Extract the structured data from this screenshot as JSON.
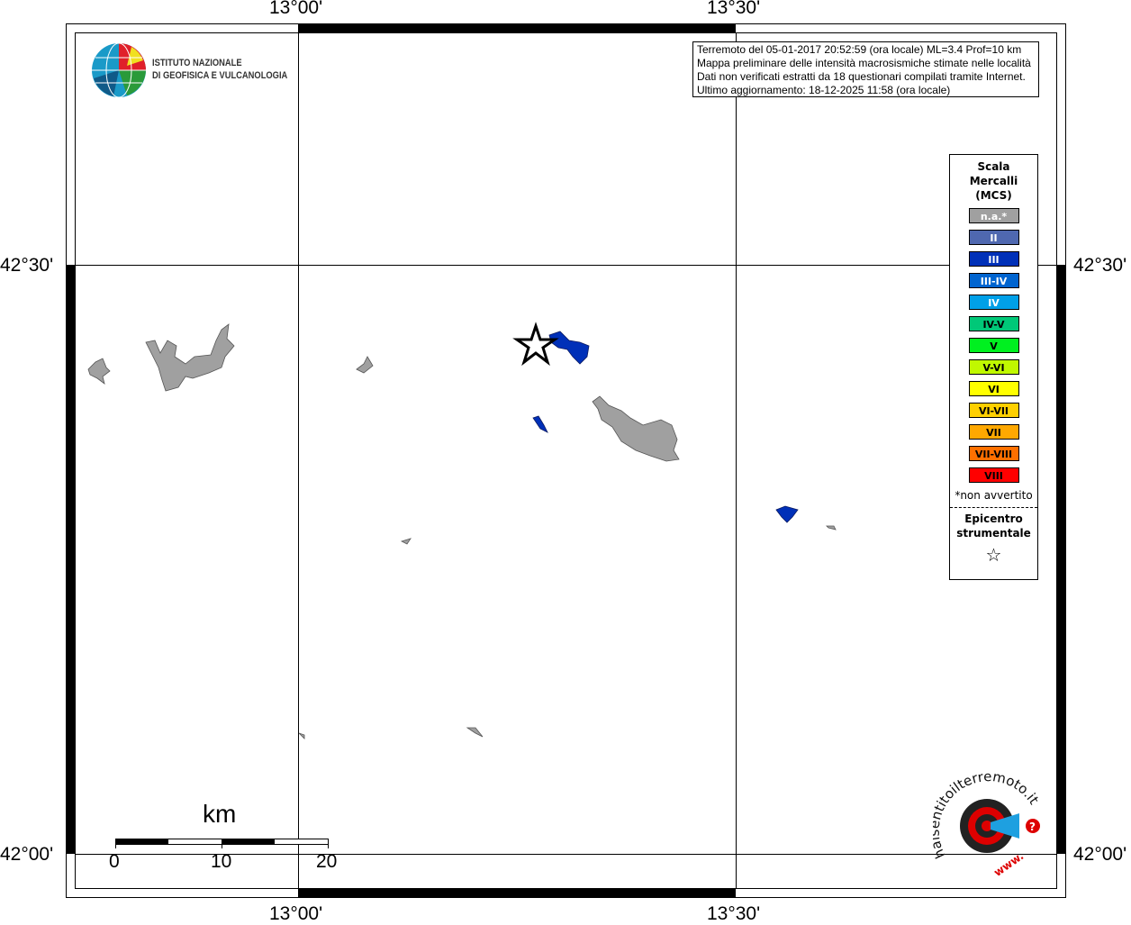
{
  "axes": {
    "lon_ticks": [
      "13°00'",
      "13°30'"
    ],
    "lat_ticks": [
      "42°30'",
      "42°00'"
    ]
  },
  "info": {
    "lines": [
      "Terremoto del 05-01-2017 20:52:59 (ora locale) ML=3.4 Prof=10 km",
      "Mappa preliminare delle intensità macrosismiche stimate nelle località",
      "Dati non verificati estratti da 18 questionari compilati tramite Internet.",
      "Ultimo aggiornamento: 18-12-2025 11:58 (ora locale)"
    ]
  },
  "logo": {
    "line1": "ISTITUTO NAZIONALE",
    "line2": "DI GEOFISICA E VULCANOLOGIA"
  },
  "legend": {
    "title": [
      "Scala",
      "Mercalli",
      "(MCS)"
    ],
    "items": [
      {
        "label": "n.a.*",
        "color": "#a0a0a0",
        "text": "#ffffff"
      },
      {
        "label": "II",
        "color": "#4f68b0",
        "text": "#ffffff"
      },
      {
        "label": "III",
        "color": "#0030b8",
        "text": "#ffffff"
      },
      {
        "label": "III-IV",
        "color": "#0064d0",
        "text": "#ffffff"
      },
      {
        "label": "IV",
        "color": "#00a0e8",
        "text": "#ffffff"
      },
      {
        "label": "IV-V",
        "color": "#00c878",
        "text": "#000000"
      },
      {
        "label": "V",
        "color": "#00f020",
        "text": "#000000"
      },
      {
        "label": "V-VI",
        "color": "#c0f800",
        "text": "#000000"
      },
      {
        "label": "VI",
        "color": "#ffff00",
        "text": "#000000"
      },
      {
        "label": "VI-VII",
        "color": "#ffd000",
        "text": "#000000"
      },
      {
        "label": "VII",
        "color": "#ffa800",
        "text": "#000000"
      },
      {
        "label": "VII-VIII",
        "color": "#ff7000",
        "text": "#000000"
      },
      {
        "label": "VIII",
        "color": "#ff0000",
        "text": "#000000"
      }
    ],
    "note": "*non avvertito",
    "epicentre": [
      "Epicentro",
      "strumentale"
    ]
  },
  "scale": {
    "unit": "km",
    "labels": [
      "0",
      "10",
      "20"
    ]
  },
  "brand": {
    "text": "haisentitoilterremoto.it",
    "www": "www."
  }
}
